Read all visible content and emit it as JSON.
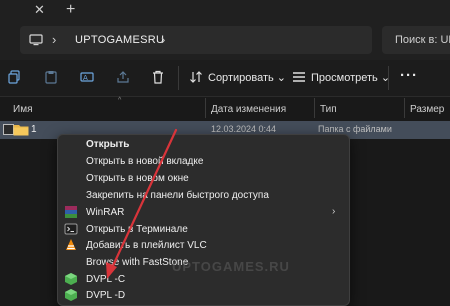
{
  "tabs": {
    "close_glyph": "✕",
    "new_glyph": "+"
  },
  "address": {
    "separator_glyph": "›",
    "crumb": "UPTOGAMESRU",
    "search_placeholder": "Поиск в: UP"
  },
  "toolbar": {
    "sort_label": "Сортировать",
    "view_label": "Просмотреть",
    "dropdown_glyph": "⌄",
    "more_glyph": "···",
    "icons": [
      "copy-icon",
      "paste-icon",
      "rename-icon",
      "share-icon",
      "delete-icon",
      "sort-icon",
      "view-icon"
    ]
  },
  "columns": {
    "name": "Имя",
    "date": "Дата изменения",
    "type": "Тип",
    "size": "Размер",
    "sort_glyph": "^"
  },
  "row": {
    "name": "1",
    "date": "12.03.2024 0:44",
    "type": "Папка с файлами"
  },
  "context_menu": {
    "items": [
      {
        "label": "Открыть",
        "bold": true
      },
      {
        "label": "Открыть в новой вкладке"
      },
      {
        "label": "Открыть в новом окне"
      },
      {
        "label": "Закрепить на панели быстрого доступа"
      },
      {
        "label": "WinRAR",
        "icon": "winrar-icon",
        "submenu": true
      },
      {
        "label": "Открыть в Терминале",
        "icon": "terminal-icon"
      },
      {
        "label": "Добавить в плейлист VLC",
        "icon": "vlc-icon"
      },
      {
        "label": "Browse with FastStone"
      },
      {
        "label": "DVPL -C",
        "icon": "dvpl-icon"
      },
      {
        "label": "DVPL -D",
        "icon": "dvpl-icon"
      }
    ],
    "submenu_glyph": "›"
  },
  "watermark": "UPTOGAMES.RU",
  "colors": {
    "selection": "#444d5a",
    "arrow": "#d8343a",
    "menu_bg": "#2c2c2c"
  }
}
